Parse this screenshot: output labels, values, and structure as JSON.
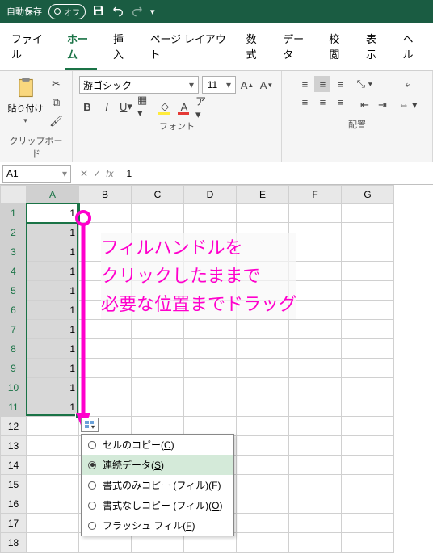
{
  "titlebar": {
    "autosave": "自動保存",
    "autosave_state": "オフ"
  },
  "tabs": {
    "file": "ファイル",
    "home": "ホーム",
    "insert": "挿入",
    "pagelayout": "ページ レイアウト",
    "formulas": "数式",
    "data": "データ",
    "review": "校閲",
    "view": "表示",
    "help": "ヘル"
  },
  "ribbon": {
    "clipboard_label": "クリップボード",
    "paste": "貼り付け",
    "font_label": "フォント",
    "font_name": "游ゴシック",
    "font_size": "11",
    "align_label": "配置"
  },
  "formula_bar": {
    "name_box": "A1",
    "formula": "1"
  },
  "columns": [
    "A",
    "B",
    "C",
    "D",
    "E",
    "F",
    "G"
  ],
  "rows_visible": 18,
  "fill_values": [
    "1",
    "1",
    "1",
    "1",
    "1",
    "1",
    "1",
    "1",
    "1",
    "1",
    "1"
  ],
  "annotation": {
    "line1": "フィルハンドルを",
    "line2": "クリックしたままで",
    "line3": "必要な位置までドラッグ"
  },
  "autofill_menu": {
    "items": [
      {
        "label": "セルのコピー(",
        "hotkey": "C",
        "suffix": ")"
      },
      {
        "label": "連続データ(",
        "hotkey": "S",
        "suffix": ")"
      },
      {
        "label": "書式のみコピー (フィル)(",
        "hotkey": "F",
        "suffix": ")"
      },
      {
        "label": "書式なしコピー (フィル)(",
        "hotkey": "O",
        "suffix": ")"
      },
      {
        "label": "フラッシュ フィル(",
        "hotkey": "F",
        "suffix": ")"
      }
    ],
    "selected_index": 1
  }
}
